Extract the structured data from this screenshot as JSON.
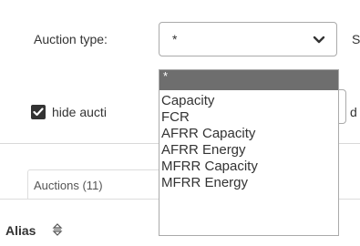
{
  "filters": {
    "auction_type_label": "Auction type:",
    "auction_type_value": "*",
    "cut_letter": "S",
    "hide_label": "hide aucti",
    "cut_letter_2": "d",
    "hide_checked": true
  },
  "dropdown": {
    "options": [
      "*",
      "Capacity",
      "FCR",
      "AFRR Capacity",
      "AFRR Energy",
      "MFRR Capacity",
      "MFRR Energy"
    ],
    "selected_index": 0
  },
  "tabs": {
    "auctions_label": "Auctions (11)"
  },
  "table": {
    "alias_header": "Alias"
  },
  "colors": {
    "selected_bg": "#6e6e6e",
    "border": "#aaaaaa",
    "text": "#333333"
  },
  "icons": {
    "select_chevron": "chevron-down-icon",
    "sort": "sort-icon",
    "check": "check-icon"
  }
}
